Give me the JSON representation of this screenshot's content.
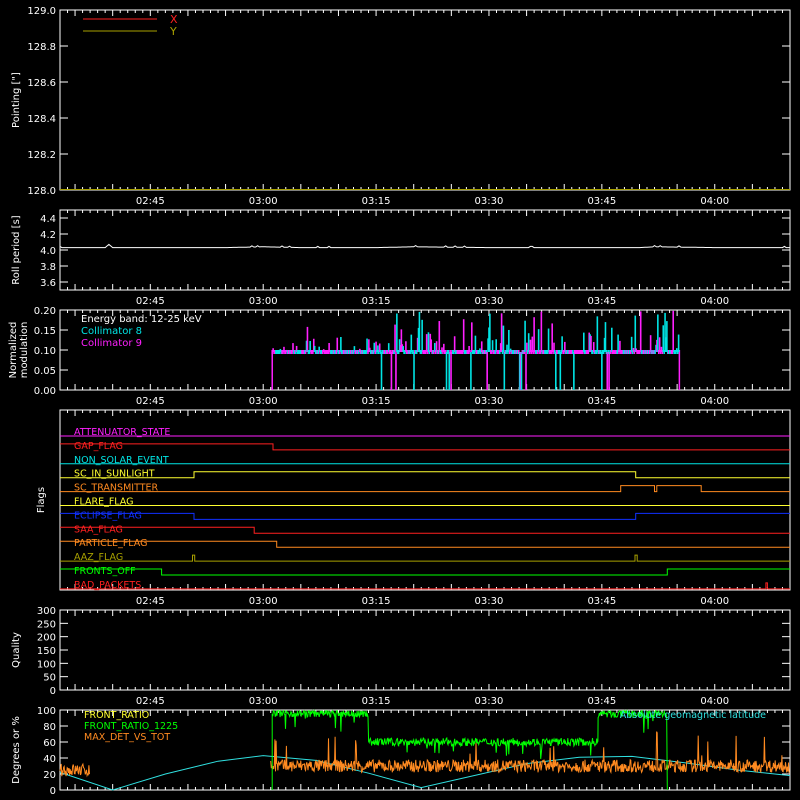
{
  "colors": {
    "background": "#000000",
    "axis": "#ffffff",
    "red": "#ff2020",
    "olive": "#a8a000",
    "white": "#ffffff",
    "cyan": "#00e5e5",
    "magenta": "#ff20ff",
    "yellow": "#ffff30",
    "blue": "#1030ff",
    "orange": "#ff8a20",
    "green": "#00ff00",
    "teal": "#30e0e0",
    "light_green": "#60ff30"
  },
  "time_axis": {
    "start_min": 153,
    "end_min": 250,
    "ticks": [
      {
        "min": 165,
        "label": "02:45"
      },
      {
        "min": 180,
        "label": "03:00"
      },
      {
        "min": 195,
        "label": "03:15"
      },
      {
        "min": 210,
        "label": "03:30"
      },
      {
        "min": 225,
        "label": "03:45"
      },
      {
        "min": 240,
        "label": "04:00"
      }
    ]
  },
  "chart_data": [
    {
      "id": "pointing",
      "type": "line",
      "ylabel": "Pointing [\"]",
      "ylim": [
        128.0,
        129.0
      ],
      "yticks": [
        {
          "v": 128.0,
          "label": "128.0"
        },
        {
          "v": 128.2,
          "label": "128.2"
        },
        {
          "v": 128.4,
          "label": "128.4"
        },
        {
          "v": 128.6,
          "label": "128.6"
        },
        {
          "v": 128.8,
          "label": "128.8"
        },
        {
          "v": 129.0,
          "label": "129.0"
        }
      ],
      "series": [
        {
          "name": "X",
          "color": "red",
          "x": [
            153,
            250
          ],
          "y": [
            128.0,
            128.0
          ]
        },
        {
          "name": "Y",
          "color": "olive",
          "x": [
            153,
            250
          ],
          "y": [
            128.0,
            128.0
          ]
        }
      ],
      "legend": "top-left"
    },
    {
      "id": "roll",
      "type": "line",
      "ylabel": "Roll period [s]",
      "ylim": [
        3.5,
        4.5
      ],
      "yticks": [
        {
          "v": 3.6,
          "label": "3.6"
        },
        {
          "v": 3.8,
          "label": "3.8"
        },
        {
          "v": 4.0,
          "label": "4.0"
        },
        {
          "v": 4.2,
          "label": "4.2"
        },
        {
          "v": 4.4,
          "label": "4.4"
        }
      ],
      "series": [
        {
          "name": "",
          "color": "white",
          "x": [
            153,
            156,
            159,
            159.5,
            160,
            161,
            165,
            175,
            180,
            185,
            195,
            200,
            210,
            220,
            230,
            232,
            240,
            250
          ],
          "y": [
            4.03,
            4.03,
            4.03,
            4.07,
            4.03,
            4.03,
            4.03,
            4.03,
            4.04,
            4.03,
            4.03,
            4.04,
            4.03,
            4.03,
            4.03,
            4.04,
            4.03,
            4.03
          ]
        }
      ]
    },
    {
      "id": "modulation",
      "type": "bar",
      "ylabel_lines": [
        "Normalized",
        "modulation"
      ],
      "ylim": [
        0,
        0.2
      ],
      "yticks": [
        {
          "v": 0.0,
          "label": "0.00"
        },
        {
          "v": 0.05,
          "label": "0.05"
        },
        {
          "v": 0.1,
          "label": "0.10"
        },
        {
          "v": 0.15,
          "label": "0.15"
        },
        {
          "v": 0.2,
          "label": "0.20"
        }
      ],
      "x_range": [
        181.2,
        235.3
      ],
      "baseline": 0.095,
      "annotations": [
        "Energy band: 12-25 keV"
      ],
      "series": [
        {
          "name": "Collimator 8",
          "color": "cyan"
        },
        {
          "name": "Collimator 9",
          "color": "magenta"
        }
      ]
    },
    {
      "id": "flags",
      "type": "line",
      "ylabel": "Flags",
      "flags": [
        {
          "name": "ATTENUATOR_STATE",
          "color": "magenta",
          "steps": [
            [
              153,
              0
            ],
            [
              250,
              0
            ]
          ]
        },
        {
          "name": "GAP_FLAG",
          "color": "red",
          "steps": [
            [
              153,
              1
            ],
            [
              181.3,
              0
            ],
            [
              250,
              0
            ]
          ]
        },
        {
          "name": "NON_SOLAR_EVENT",
          "color": "cyan",
          "steps": [
            [
              153,
              0
            ],
            [
              250,
              0
            ]
          ]
        },
        {
          "name": "SC_IN_SUNLIGHT",
          "color": "yellow",
          "steps": [
            [
              153,
              0
            ],
            [
              170.8,
              1
            ],
            [
              229.5,
              0
            ],
            [
              250,
              0
            ]
          ]
        },
        {
          "name": "SC_TRANSMITTER",
          "color": "orange",
          "steps": [
            [
              153,
              0
            ],
            [
              227.5,
              1
            ],
            [
              232,
              0
            ],
            [
              232.3,
              1
            ],
            [
              238.2,
              0
            ],
            [
              250,
              0
            ]
          ]
        },
        {
          "name": "FLARE_FLAG",
          "color": "yellow",
          "steps": [
            [
              153,
              0
            ],
            [
              250,
              0
            ]
          ]
        },
        {
          "name": "ECLIPSE_FLAG",
          "color": "blue",
          "steps": [
            [
              153,
              1
            ],
            [
              170.8,
              0
            ],
            [
              229.5,
              1
            ],
            [
              250,
              1
            ]
          ]
        },
        {
          "name": "SAA_FLAG",
          "color": "red",
          "steps": [
            [
              153,
              1
            ],
            [
              178.8,
              0
            ],
            [
              250,
              0
            ]
          ]
        },
        {
          "name": "PARTICLE_FLAG",
          "color": "orange",
          "steps": [
            [
              153,
              1
            ],
            [
              181.8,
              0
            ],
            [
              250,
              0
            ]
          ]
        },
        {
          "name": "AAZ_FLAG",
          "color": "olive",
          "steps": [
            [
              153,
              0
            ],
            [
              170.6,
              1
            ],
            [
              170.9,
              0
            ],
            [
              229.4,
              1
            ],
            [
              229.7,
              0
            ],
            [
              250,
              0
            ]
          ]
        },
        {
          "name": "FRONTS_OFF",
          "color": "green",
          "steps": [
            [
              153,
              1
            ],
            [
              166.5,
              0
            ],
            [
              233.7,
              1
            ],
            [
              250,
              1
            ]
          ]
        },
        {
          "name": "BAD_PACKETS",
          "color": "red",
          "steps": [
            [
              153,
              0
            ],
            [
              246.8,
              1
            ],
            [
              247,
              0
            ],
            [
              250,
              0
            ]
          ]
        }
      ]
    },
    {
      "id": "quality",
      "type": "line",
      "ylabel": "Quality",
      "ylim": [
        0,
        300
      ],
      "yticks": [
        {
          "v": 0,
          "label": "0"
        },
        {
          "v": 50,
          "label": "50"
        },
        {
          "v": 100,
          "label": "100"
        },
        {
          "v": 150,
          "label": "150"
        },
        {
          "v": 200,
          "label": "200"
        },
        {
          "v": 250,
          "label": "250"
        },
        {
          "v": 300,
          "label": "300"
        }
      ],
      "series": []
    },
    {
      "id": "ratios",
      "type": "line",
      "ylabel": "Degrees or %",
      "ylim": [
        0,
        100
      ],
      "yticks": [
        {
          "v": 0,
          "label": "0"
        },
        {
          "v": 20,
          "label": "20"
        },
        {
          "v": 40,
          "label": "40"
        },
        {
          "v": 60,
          "label": "60"
        },
        {
          "v": 80,
          "label": "80"
        },
        {
          "v": 100,
          "label": "100"
        }
      ],
      "series": [
        {
          "name": "FRONT_RATIO",
          "color": "yellow"
        },
        {
          "name": "FRONT_RATIO_1225",
          "color": "green",
          "segments": [
            {
              "x": [
                181.2,
                194.0
              ],
              "y": 96
            },
            {
              "x": [
                194.0,
                224.5
              ],
              "y": 60
            },
            {
              "x": [
                224.5,
                233.7
              ],
              "y": 95
            }
          ],
          "step_x": [
            181.2,
            233.7
          ]
        },
        {
          "name": "MAX_DET_VS_TOT",
          "color": "orange",
          "segments": [
            {
              "x": [
                153,
                157.0
              ],
              "y": 25
            },
            {
              "x": [
                181.0,
                250
              ],
              "y": 30
            }
          ]
        },
        {
          "name": "Absolute geomagnetic latitude",
          "color": "teal",
          "x": [
            153,
            160,
            167,
            174,
            180,
            187,
            194,
            201,
            208,
            215,
            222,
            229,
            236,
            243,
            250
          ],
          "y": [
            22,
            0,
            20,
            36,
            43,
            37,
            21,
            3,
            18,
            33,
            41,
            42,
            34,
            25,
            18
          ]
        }
      ]
    }
  ]
}
